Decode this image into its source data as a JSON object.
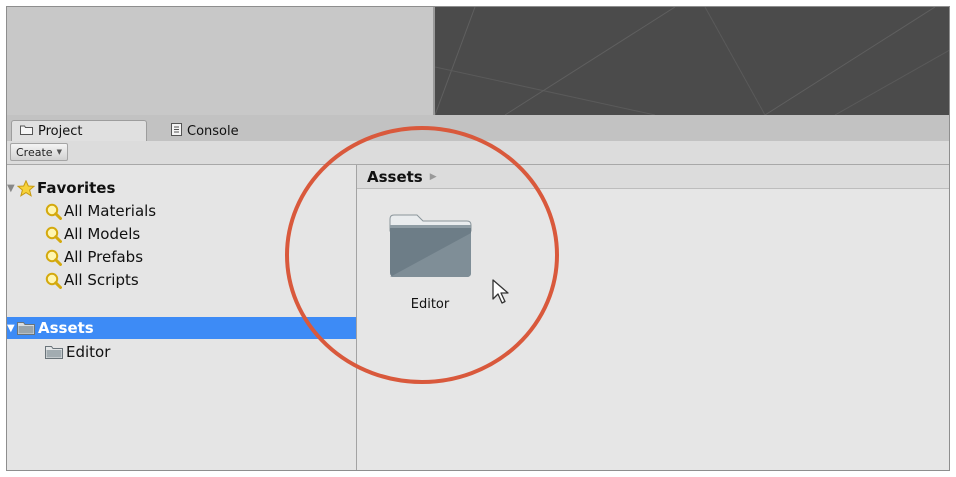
{
  "colors": {
    "selection": "#3d8bf6",
    "highlight_ring": "#d9593c",
    "scene_bg": "#4b4b4b",
    "folder": "#6d7d87"
  },
  "tabs": [
    {
      "label": "Project",
      "icon": "folder-icon",
      "active": true
    },
    {
      "label": "Console",
      "icon": "console-icon",
      "active": false
    }
  ],
  "toolbar": {
    "create_label": "Create"
  },
  "favorites": {
    "label": "Favorites",
    "icon": "star-icon",
    "items": [
      {
        "label": "All Materials",
        "icon": "search-icon"
      },
      {
        "label": "All Models",
        "icon": "search-icon"
      },
      {
        "label": "All Prefabs",
        "icon": "search-icon"
      },
      {
        "label": "All Scripts",
        "icon": "search-icon"
      }
    ]
  },
  "assets_tree": {
    "label": "Assets",
    "icon": "folder-icon",
    "selected": true,
    "children": [
      {
        "label": "Editor",
        "icon": "folder-icon"
      }
    ]
  },
  "content": {
    "breadcrumb": "Assets",
    "items": [
      {
        "label": "Editor",
        "icon": "folder-icon"
      }
    ]
  }
}
